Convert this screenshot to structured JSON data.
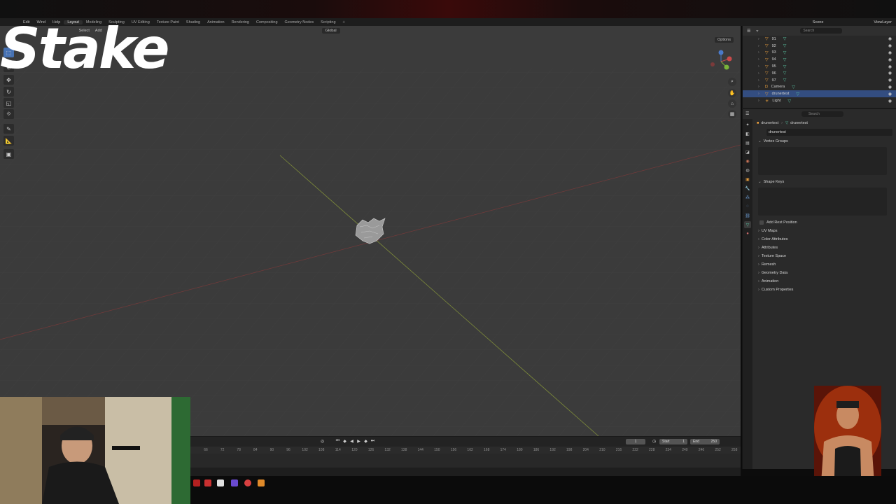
{
  "menu": {
    "items": [
      "Edit",
      "Wind",
      "Help"
    ],
    "workspaces": [
      "Layout",
      "Modeling",
      "Sculpting",
      "UV Editing",
      "Texture Paint",
      "Shading",
      "Animation",
      "Rendering",
      "Compositing",
      "Geometry Nodes",
      "Scripting",
      "+"
    ],
    "active_workspace": "Layout",
    "scene": "Scene",
    "view_layer": "ViewLayer"
  },
  "viewport_header": {
    "mode": "Obje",
    "menus": [
      "Select",
      "Add"
    ],
    "transform": "Global",
    "options": "Options"
  },
  "tools": [
    {
      "icon": "select-cursor-icon"
    },
    {
      "icon": "cursor-icon"
    },
    {
      "icon": "move-icon"
    },
    {
      "icon": "rotate-icon"
    },
    {
      "icon": "scale-icon"
    },
    {
      "icon": "transform-icon"
    },
    {
      "icon": "annotate-icon"
    },
    {
      "icon": "measure-icon"
    },
    {
      "icon": "add-cube-icon"
    }
  ],
  "timeline": {
    "current_frame": "1",
    "start_label": "Start",
    "start": "1",
    "end_label": "End",
    "end": "250",
    "ruler": [
      "66",
      "72",
      "78",
      "84",
      "90",
      "96",
      "102",
      "108",
      "114",
      "120",
      "126",
      "132",
      "138",
      "144",
      "150",
      "156",
      "162",
      "168",
      "174",
      "180",
      "186",
      "192",
      "198",
      "204",
      "210",
      "216",
      "222",
      "228",
      "234",
      "240",
      "246",
      "252",
      "258"
    ]
  },
  "outliner": {
    "search_placeholder": "Search",
    "rows": [
      {
        "label": "91",
        "type": "mesh",
        "selected": false
      },
      {
        "label": "92",
        "type": "mesh",
        "selected": false
      },
      {
        "label": "93",
        "type": "mesh",
        "selected": false
      },
      {
        "label": "94",
        "type": "mesh",
        "selected": false
      },
      {
        "label": "95",
        "type": "mesh",
        "selected": false
      },
      {
        "label": "96",
        "type": "mesh",
        "selected": false
      },
      {
        "label": "97",
        "type": "mesh",
        "selected": false
      },
      {
        "label": "Camera",
        "type": "camera",
        "selected": false
      },
      {
        "label": "drunertest",
        "type": "mesh",
        "selected": true
      },
      {
        "label": "Light",
        "type": "light",
        "selected": false
      }
    ]
  },
  "properties": {
    "search_placeholder": "Search",
    "breadcrumb_object": "drunertest",
    "breadcrumb_data": "drunertest",
    "data_name": "drunertest",
    "panels": {
      "vertex_groups": "Vertex Groups",
      "shape_keys": "Shape Keys",
      "add_rest_position": "Add Rest Position",
      "collapsed": [
        "UV Maps",
        "Color Attributes",
        "Attributes",
        "Texture Space",
        "Remesh",
        "Geometry Data",
        "Animation",
        "Custom Properties"
      ]
    }
  },
  "overlay": {
    "logo_text": "Stake"
  },
  "colors": {
    "accent": "#4772b3",
    "selected_row": "#334d80",
    "viewport_bg": "#3b3b3b",
    "x_axis": "#8a3a3a",
    "y_axis": "#8a9a3a"
  }
}
